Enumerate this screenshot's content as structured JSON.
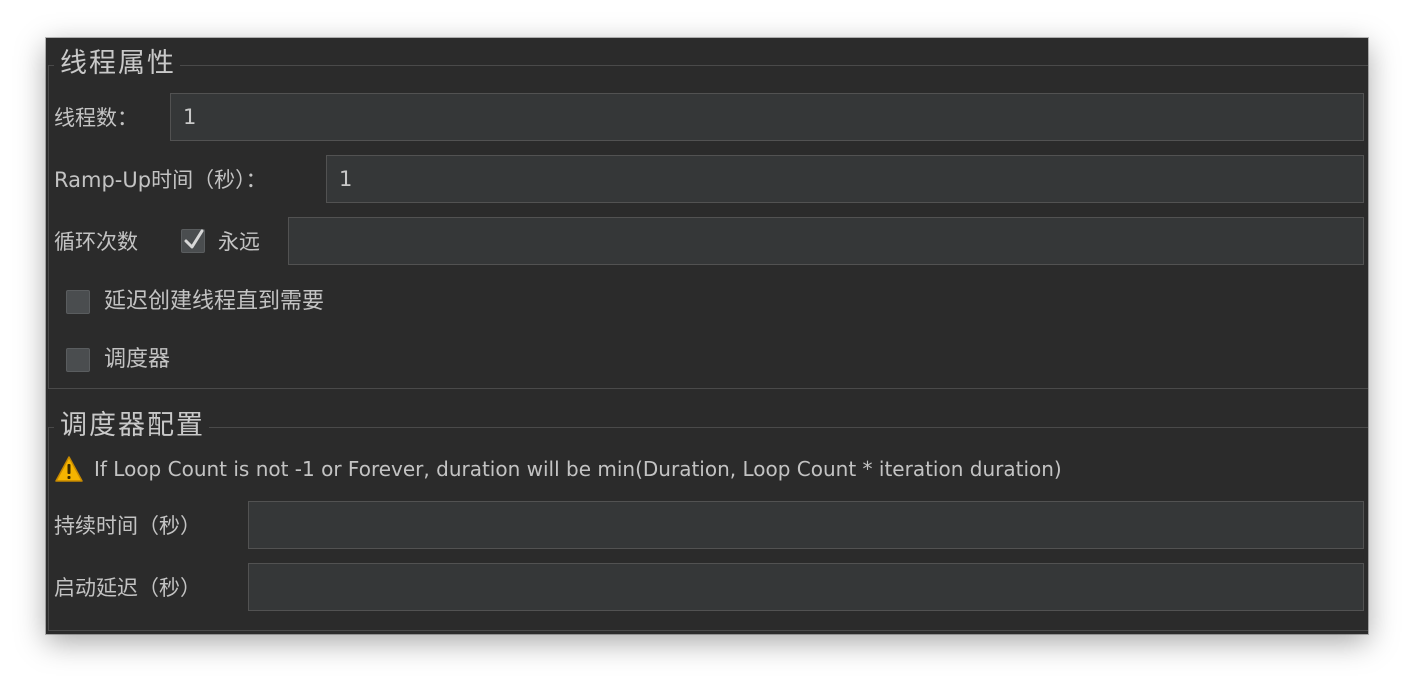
{
  "thread_properties": {
    "title": "线程属性",
    "threads_label": "线程数：",
    "threads_value": "1",
    "rampup_label": "Ramp-Up时间（秒）：",
    "rampup_value": "1",
    "loop_label": "循环次数",
    "forever_label": "永远",
    "forever_checked": true,
    "loop_value": "",
    "delay_create_label": "延迟创建线程直到需要",
    "delay_create_checked": false,
    "scheduler_label": "调度器",
    "scheduler_checked": false
  },
  "scheduler_config": {
    "title": "调度器配置",
    "warning_icon": "warning-icon",
    "warning_text": "If Loop Count is not -1 or Forever, duration will be min(Duration, Loop Count * iteration duration)",
    "duration_label": "持续时间（秒）",
    "duration_value": "",
    "startup_delay_label": "启动延迟（秒）",
    "startup_delay_value": ""
  },
  "colors": {
    "background": "#2b2b2b",
    "field": "#353738",
    "text": "#c3c3c3",
    "warning": "#f5b400"
  }
}
